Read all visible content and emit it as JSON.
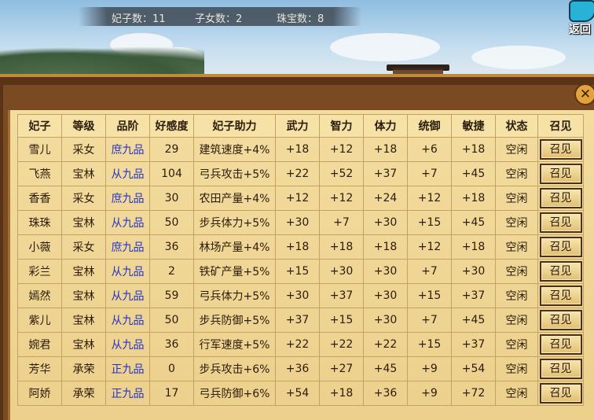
{
  "stats": {
    "consorts_label": "妃子数：",
    "consorts_value": "11",
    "children_label": "子女数：",
    "children_value": "2",
    "jewels_label": "珠宝数：",
    "jewels_value": "8"
  },
  "return_button": {
    "label": "返回"
  },
  "close_button": {
    "glyph": "✕"
  },
  "table": {
    "headers": [
      "妃子",
      "等级",
      "品阶",
      "好感度",
      "妃子助力",
      "武力",
      "智力",
      "体力",
      "统御",
      "敏捷",
      "状态",
      "召见"
    ],
    "rows": [
      {
        "name": "雪儿",
        "rank": "采女",
        "grade": "庶九品",
        "affection": "29",
        "bonus": "建筑速度+4%",
        "force": "+18",
        "intellect": "+12",
        "stamina": "+18",
        "command": "+6",
        "agility": "+18",
        "status": "空闲",
        "action": "召见"
      },
      {
        "name": "飞燕",
        "rank": "宝林",
        "grade": "从九品",
        "affection": "104",
        "bonus": "弓兵攻击+5%",
        "force": "+22",
        "intellect": "+52",
        "stamina": "+37",
        "command": "+7",
        "agility": "+45",
        "status": "空闲",
        "action": "召见"
      },
      {
        "name": "香香",
        "rank": "采女",
        "grade": "庶九品",
        "affection": "30",
        "bonus": "农田产量+4%",
        "force": "+12",
        "intellect": "+12",
        "stamina": "+24",
        "command": "+12",
        "agility": "+18",
        "status": "空闲",
        "action": "召见"
      },
      {
        "name": "珠珠",
        "rank": "宝林",
        "grade": "从九品",
        "affection": "50",
        "bonus": "步兵体力+5%",
        "force": "+30",
        "intellect": "+7",
        "stamina": "+30",
        "command": "+15",
        "agility": "+45",
        "status": "空闲",
        "action": "召见"
      },
      {
        "name": "小薇",
        "rank": "采女",
        "grade": "庶九品",
        "affection": "36",
        "bonus": "林场产量+4%",
        "force": "+18",
        "intellect": "+18",
        "stamina": "+18",
        "command": "+12",
        "agility": "+18",
        "status": "空闲",
        "action": "召见"
      },
      {
        "name": "彩兰",
        "rank": "宝林",
        "grade": "从九品",
        "affection": "2",
        "bonus": "铁矿产量+5%",
        "force": "+15",
        "intellect": "+30",
        "stamina": "+30",
        "command": "+7",
        "agility": "+30",
        "status": "空闲",
        "action": "召见"
      },
      {
        "name": "嫣然",
        "rank": "宝林",
        "grade": "从九品",
        "affection": "59",
        "bonus": "弓兵体力+5%",
        "force": "+30",
        "intellect": "+37",
        "stamina": "+30",
        "command": "+15",
        "agility": "+37",
        "status": "空闲",
        "action": "召见"
      },
      {
        "name": "紫儿",
        "rank": "宝林",
        "grade": "从九品",
        "affection": "50",
        "bonus": "步兵防御+5%",
        "force": "+37",
        "intellect": "+15",
        "stamina": "+30",
        "command": "+7",
        "agility": "+45",
        "status": "空闲",
        "action": "召见"
      },
      {
        "name": "婉君",
        "rank": "宝林",
        "grade": "从九品",
        "affection": "36",
        "bonus": "行军速度+5%",
        "force": "+22",
        "intellect": "+22",
        "stamina": "+22",
        "command": "+15",
        "agility": "+37",
        "status": "空闲",
        "action": "召见"
      },
      {
        "name": "芳华",
        "rank": "承荣",
        "grade": "正九品",
        "affection": "0",
        "bonus": "步兵攻击+6%",
        "force": "+36",
        "intellect": "+27",
        "stamina": "+45",
        "command": "+9",
        "agility": "+54",
        "status": "空闲",
        "action": "召见"
      },
      {
        "name": "阿娇",
        "rank": "承荣",
        "grade": "正九品",
        "affection": "17",
        "bonus": "弓兵防御+6%",
        "force": "+54",
        "intellect": "+18",
        "stamina": "+36",
        "command": "+9",
        "agility": "+72",
        "status": "空闲",
        "action": "召见"
      }
    ]
  }
}
